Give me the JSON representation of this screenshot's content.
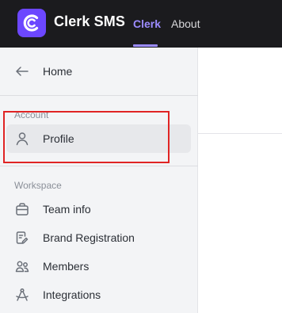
{
  "header": {
    "app_name": "Clerk SMS",
    "nav": [
      {
        "label": "Clerk",
        "active": true
      },
      {
        "label": "About",
        "active": false
      }
    ]
  },
  "sidebar": {
    "home": {
      "label": "Home",
      "icon": "arrow-left-icon"
    },
    "account_section": {
      "title": "Account",
      "items": [
        {
          "label": "Profile",
          "icon": "user-icon",
          "selected": true
        }
      ]
    },
    "workspace_section": {
      "title": "Workspace",
      "items": [
        {
          "label": "Team info",
          "icon": "briefcase-icon"
        },
        {
          "label": "Brand Registration",
          "icon": "document-edit-icon"
        },
        {
          "label": "Members",
          "icon": "users-icon"
        },
        {
          "label": "Integrations",
          "icon": "compass-icon"
        }
      ]
    }
  },
  "colors": {
    "accent": "#6c47ff",
    "topbar": "#1b1b1e",
    "active_nav": "#9c8cff",
    "highlight": "#e02424"
  }
}
